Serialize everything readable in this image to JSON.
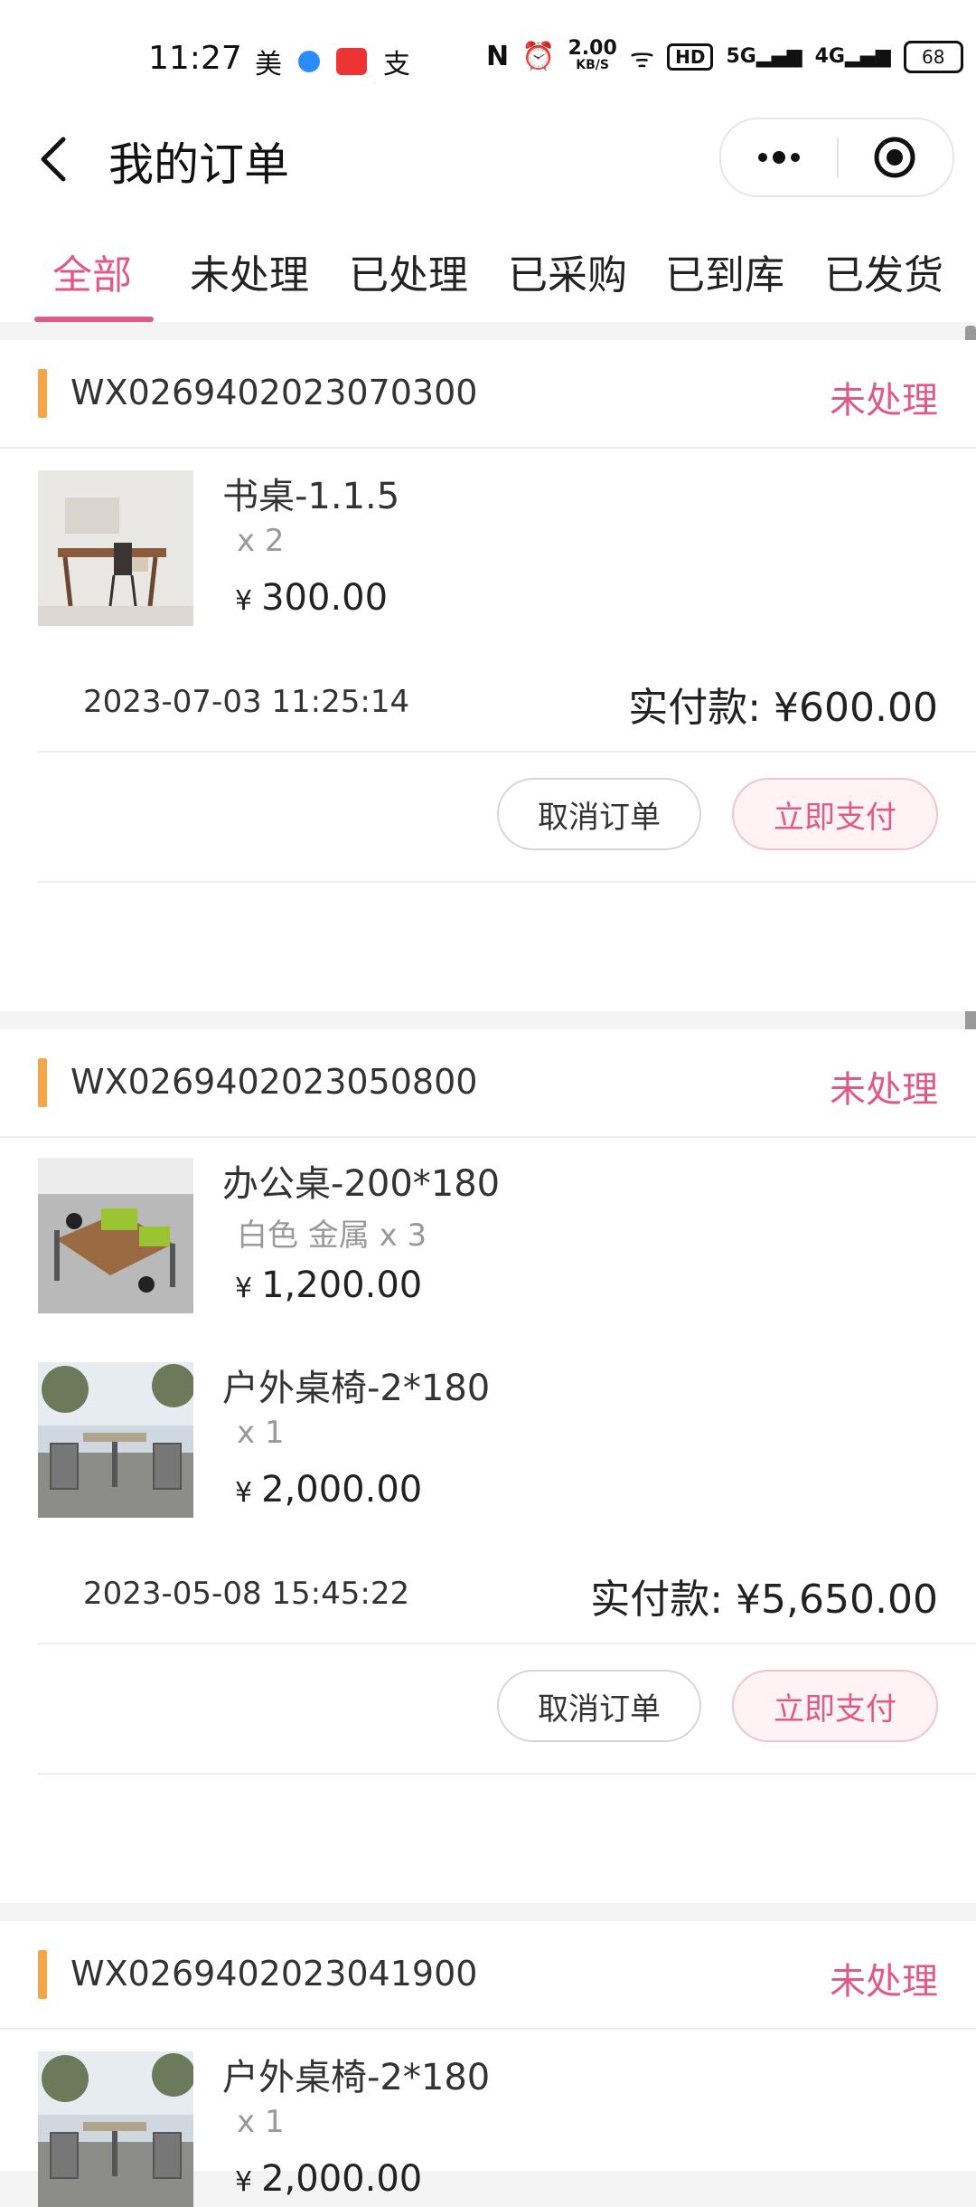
{
  "status_bar": {
    "time": "11:27",
    "left_icons": [
      "美",
      "支"
    ],
    "net_speed": "2.00",
    "net_unit": "KB/S",
    "hd": "HD",
    "sig1": "5G",
    "sig2": "4G",
    "battery": "68"
  },
  "nav": {
    "title": "我的订单"
  },
  "tabs": [
    "全部",
    "未处理",
    "已处理",
    "已采购",
    "已到库",
    "已发货"
  ],
  "orders": [
    {
      "order_no": "WX0269402023070300",
      "status": "未处理",
      "items": [
        {
          "name": "书桌-1.1.5",
          "spec": "x 2",
          "currency": "¥",
          "price": "300.00"
        }
      ],
      "date": "2023-07-03 11:25:14",
      "paid": "实付款: ¥600.00",
      "cancel_label": "取消订单",
      "pay_label": "立即支付"
    },
    {
      "order_no": "WX0269402023050800",
      "status": "未处理",
      "items": [
        {
          "name": "办公桌-200*180",
          "spec": "白色 金属 x 3",
          "currency": "¥",
          "price": "1,200.00"
        },
        {
          "name": "户外桌椅-2*180",
          "spec": "x 1",
          "currency": "¥",
          "price": "2,000.00"
        }
      ],
      "date": "2023-05-08 15:45:22",
      "paid": "实付款: ¥5,650.00",
      "cancel_label": "取消订单",
      "pay_label": "立即支付"
    },
    {
      "order_no": "WX0269402023041900",
      "status": "未处理",
      "items": [
        {
          "name": "户外桌椅-2*180",
          "spec": "x 1",
          "currency": "¥",
          "price": "2,000.00"
        }
      ]
    }
  ],
  "colors": {
    "accent": "#e05a86",
    "order_marker": "#f4a64b"
  }
}
